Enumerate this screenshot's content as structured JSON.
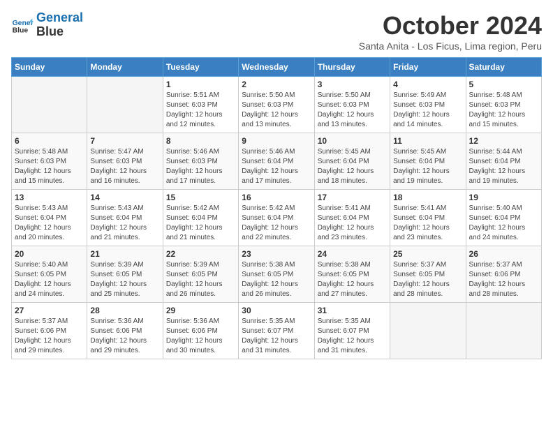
{
  "header": {
    "logo_line1": "General",
    "logo_line2": "Blue",
    "month": "October 2024",
    "subtitle": "Santa Anita - Los Ficus, Lima region, Peru"
  },
  "weekdays": [
    "Sunday",
    "Monday",
    "Tuesday",
    "Wednesday",
    "Thursday",
    "Friday",
    "Saturday"
  ],
  "weeks": [
    [
      {
        "day": "",
        "info": ""
      },
      {
        "day": "",
        "info": ""
      },
      {
        "day": "1",
        "info": "Sunrise: 5:51 AM\nSunset: 6:03 PM\nDaylight: 12 hours and 12 minutes."
      },
      {
        "day": "2",
        "info": "Sunrise: 5:50 AM\nSunset: 6:03 PM\nDaylight: 12 hours and 13 minutes."
      },
      {
        "day": "3",
        "info": "Sunrise: 5:50 AM\nSunset: 6:03 PM\nDaylight: 12 hours and 13 minutes."
      },
      {
        "day": "4",
        "info": "Sunrise: 5:49 AM\nSunset: 6:03 PM\nDaylight: 12 hours and 14 minutes."
      },
      {
        "day": "5",
        "info": "Sunrise: 5:48 AM\nSunset: 6:03 PM\nDaylight: 12 hours and 15 minutes."
      }
    ],
    [
      {
        "day": "6",
        "info": "Sunrise: 5:48 AM\nSunset: 6:03 PM\nDaylight: 12 hours and 15 minutes."
      },
      {
        "day": "7",
        "info": "Sunrise: 5:47 AM\nSunset: 6:03 PM\nDaylight: 12 hours and 16 minutes."
      },
      {
        "day": "8",
        "info": "Sunrise: 5:46 AM\nSunset: 6:03 PM\nDaylight: 12 hours and 17 minutes."
      },
      {
        "day": "9",
        "info": "Sunrise: 5:46 AM\nSunset: 6:04 PM\nDaylight: 12 hours and 17 minutes."
      },
      {
        "day": "10",
        "info": "Sunrise: 5:45 AM\nSunset: 6:04 PM\nDaylight: 12 hours and 18 minutes."
      },
      {
        "day": "11",
        "info": "Sunrise: 5:45 AM\nSunset: 6:04 PM\nDaylight: 12 hours and 19 minutes."
      },
      {
        "day": "12",
        "info": "Sunrise: 5:44 AM\nSunset: 6:04 PM\nDaylight: 12 hours and 19 minutes."
      }
    ],
    [
      {
        "day": "13",
        "info": "Sunrise: 5:43 AM\nSunset: 6:04 PM\nDaylight: 12 hours and 20 minutes."
      },
      {
        "day": "14",
        "info": "Sunrise: 5:43 AM\nSunset: 6:04 PM\nDaylight: 12 hours and 21 minutes."
      },
      {
        "day": "15",
        "info": "Sunrise: 5:42 AM\nSunset: 6:04 PM\nDaylight: 12 hours and 21 minutes."
      },
      {
        "day": "16",
        "info": "Sunrise: 5:42 AM\nSunset: 6:04 PM\nDaylight: 12 hours and 22 minutes."
      },
      {
        "day": "17",
        "info": "Sunrise: 5:41 AM\nSunset: 6:04 PM\nDaylight: 12 hours and 23 minutes."
      },
      {
        "day": "18",
        "info": "Sunrise: 5:41 AM\nSunset: 6:04 PM\nDaylight: 12 hours and 23 minutes."
      },
      {
        "day": "19",
        "info": "Sunrise: 5:40 AM\nSunset: 6:04 PM\nDaylight: 12 hours and 24 minutes."
      }
    ],
    [
      {
        "day": "20",
        "info": "Sunrise: 5:40 AM\nSunset: 6:05 PM\nDaylight: 12 hours and 24 minutes."
      },
      {
        "day": "21",
        "info": "Sunrise: 5:39 AM\nSunset: 6:05 PM\nDaylight: 12 hours and 25 minutes."
      },
      {
        "day": "22",
        "info": "Sunrise: 5:39 AM\nSunset: 6:05 PM\nDaylight: 12 hours and 26 minutes."
      },
      {
        "day": "23",
        "info": "Sunrise: 5:38 AM\nSunset: 6:05 PM\nDaylight: 12 hours and 26 minutes."
      },
      {
        "day": "24",
        "info": "Sunrise: 5:38 AM\nSunset: 6:05 PM\nDaylight: 12 hours and 27 minutes."
      },
      {
        "day": "25",
        "info": "Sunrise: 5:37 AM\nSunset: 6:05 PM\nDaylight: 12 hours and 28 minutes."
      },
      {
        "day": "26",
        "info": "Sunrise: 5:37 AM\nSunset: 6:06 PM\nDaylight: 12 hours and 28 minutes."
      }
    ],
    [
      {
        "day": "27",
        "info": "Sunrise: 5:37 AM\nSunset: 6:06 PM\nDaylight: 12 hours and 29 minutes."
      },
      {
        "day": "28",
        "info": "Sunrise: 5:36 AM\nSunset: 6:06 PM\nDaylight: 12 hours and 29 minutes."
      },
      {
        "day": "29",
        "info": "Sunrise: 5:36 AM\nSunset: 6:06 PM\nDaylight: 12 hours and 30 minutes."
      },
      {
        "day": "30",
        "info": "Sunrise: 5:35 AM\nSunset: 6:07 PM\nDaylight: 12 hours and 31 minutes."
      },
      {
        "day": "31",
        "info": "Sunrise: 5:35 AM\nSunset: 6:07 PM\nDaylight: 12 hours and 31 minutes."
      },
      {
        "day": "",
        "info": ""
      },
      {
        "day": "",
        "info": ""
      }
    ]
  ]
}
